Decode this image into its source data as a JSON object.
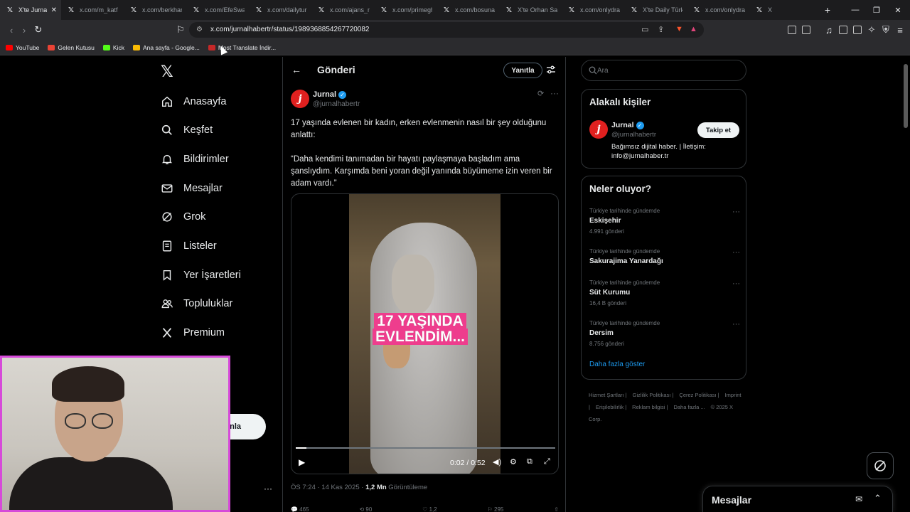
{
  "browser": {
    "tabs": [
      {
        "title": "X'te Jurnal",
        "active": true
      },
      {
        "title": "x.com/m_katf"
      },
      {
        "title": "x.com/berkhan"
      },
      {
        "title": "x.com/EfeSwan"
      },
      {
        "title": "x.com/dailyturk"
      },
      {
        "title": "x.com/ajans_m"
      },
      {
        "title": "x.com/primegh"
      },
      {
        "title": "x.com/bosunat"
      },
      {
        "title": "X'te Orhan San"
      },
      {
        "title": "x.com/onlydran"
      },
      {
        "title": "X'te Daily Türk"
      },
      {
        "title": "x.com/onlydran"
      },
      {
        "title": "X"
      }
    ],
    "url": "x.com/jurnalhabertr/status/1989368854267720082",
    "bookmarks": [
      {
        "label": "YouTube",
        "color": "#ff0000"
      },
      {
        "label": "Gelen Kutusu",
        "color": "#ea4335"
      },
      {
        "label": "Kick",
        "color": "#53fc18"
      },
      {
        "label": "Ana sayfa - Google...",
        "color": "#fbbc04"
      },
      {
        "label": "Most Translate İndir...",
        "color": "#c62828"
      }
    ]
  },
  "nav": {
    "items": [
      {
        "label": "Anasayfa",
        "icon": "home-icon"
      },
      {
        "label": "Keşfet",
        "icon": "search-icon"
      },
      {
        "label": "Bildirimler",
        "icon": "bell-icon"
      },
      {
        "label": "Mesajlar",
        "icon": "mail-icon"
      },
      {
        "label": "Grok",
        "icon": "grok-icon"
      },
      {
        "label": "Listeler",
        "icon": "list-icon"
      },
      {
        "label": "Yer İşaretleri",
        "icon": "bookmark-icon"
      },
      {
        "label": "Topluluklar",
        "icon": "people-icon"
      },
      {
        "label": "Premium",
        "icon": "x-icon"
      }
    ],
    "post_button_partial": "nla"
  },
  "post": {
    "header_title": "Gönderi",
    "reply_label": "Yanıtla",
    "author_name": "Jurnal",
    "author_handle": "@jurnalhabertr",
    "avatar_letter": "j",
    "text_line1": "17 yaşında evlenen bir kadın, erken evlenmenin nasıl bir şey olduğunu anlattı:",
    "text_line2": "“Daha kendimi tanımadan bir hayatı paylaşmaya başladım ama şanslıydım. Karşımda beni yoran değil yanında büyümeme izin veren bir adam vardı.”",
    "video_caption_1": "17 YAŞINDA",
    "video_caption_2": "EVLENDİM...",
    "video_time": "0:02 / 0:52",
    "video_progress": 0.04,
    "meta_time": "ÖS 7:24 · 14 Kas 2025 · ",
    "meta_views": "1,2 Mn",
    "meta_views_label": " Görüntüleme",
    "stats": [
      "465",
      "90",
      "1,2",
      "295"
    ]
  },
  "sidebar": {
    "search_placeholder": "Ara",
    "related": {
      "title": "Alakalı kişiler",
      "name": "Jurnal",
      "handle": "@jurnalhabertr",
      "bio": "Bağımsız dijital haber. | İletişim: info@jurnalhaber.tr",
      "follow_label": "Takip et"
    },
    "trends": {
      "title": "Neler oluyor?",
      "items": [
        {
          "context": "Türkiye tarihinde gündemde",
          "name": "Eskişehir",
          "count": "4.991 gönderi"
        },
        {
          "context": "Türkiye tarihinde gündemde",
          "name": "Sakurajima Yanardağı",
          "count": ""
        },
        {
          "context": "Türkiye tarihinde gündemde",
          "name": "Süt Kurumu",
          "count": "16,4 B gönderi"
        },
        {
          "context": "Türkiye tarihinde gündemde",
          "name": "Dersim",
          "count": "8.756 gönderi"
        }
      ],
      "show_more": "Daha fazla göster"
    },
    "footer": [
      "Hizmet Şartları |",
      "Gizlilik Politikası |",
      "Çerez Politikası |",
      "Imprint |",
      "Erişilebilirlik |",
      "Reklam bilgisi |",
      "Daha fazla ...",
      "© 2025 X Corp."
    ]
  },
  "messages_drawer": {
    "title": "Mesajlar"
  },
  "colors": {
    "accent": "#1d9bf0",
    "webcam_border": "#d64ad9",
    "caption_bg": "#ee3d8d"
  }
}
